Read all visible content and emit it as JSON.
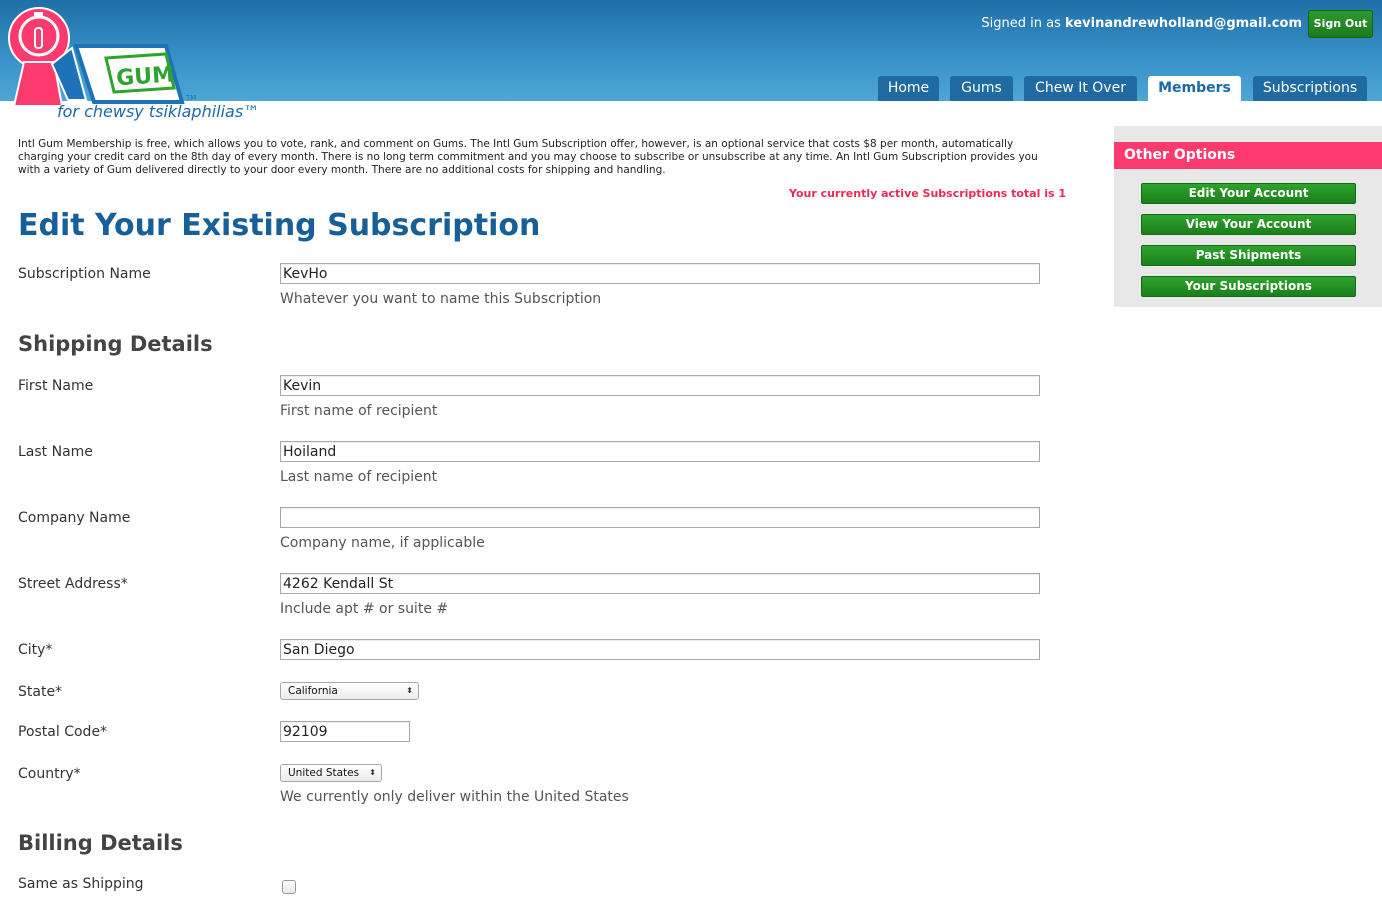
{
  "header": {
    "tagline": "for chewsy tsiklaphilias™",
    "signed_in_prefix": "Signed in as",
    "user_email": "kevinandrewholland@gmail.com",
    "sign_out_label": "Sign Out",
    "logo_text": "GUM",
    "logo_tm": "TM"
  },
  "nav": {
    "tabs": [
      {
        "label": "Home",
        "active": false
      },
      {
        "label": "Gums",
        "active": false
      },
      {
        "label": "Chew It Over",
        "active": false
      },
      {
        "label": "Members",
        "active": true
      },
      {
        "label": "Subscriptions",
        "active": false
      }
    ]
  },
  "main": {
    "intro": "Intl Gum Membership is free, which allows you to vote, rank, and comment on Gums. The Intl Gum Subscription offer, however, is an optional service that costs $8 per month, automatically charging your credit card on the 8th day of every month. There is no long term commitment and you may choose to subscribe or unsubscribe at any time. An Intl Gum Subscription provides you with a variety of Gum delivered directly to your door every month. There are no additional costs for shipping and handling.",
    "active_total": "Your currently active Subscriptions total is 1",
    "page_title": "Edit Your Existing Subscription",
    "subscription_name": {
      "label": "Subscription Name",
      "value": "KevHo",
      "help": "Whatever you want to name this Subscription"
    },
    "shipping_title": "Shipping Details",
    "first_name": {
      "label": "First Name",
      "value": "Kevin",
      "help": "First name of recipient"
    },
    "last_name": {
      "label": "Last Name",
      "value": "Hoiland",
      "help": "Last name of recipient"
    },
    "company": {
      "label": "Company Name",
      "value": "",
      "help": "Company name, if applicable"
    },
    "street": {
      "label": "Street Address*",
      "value": "4262 Kendall St",
      "help": "Include apt # or suite #"
    },
    "city": {
      "label": "City*",
      "value": "San Diego"
    },
    "state": {
      "label": "State*",
      "value": "California"
    },
    "postal": {
      "label": "Postal Code*",
      "value": "92109"
    },
    "country": {
      "label": "Country*",
      "value": "United States",
      "help": "We currently only deliver within the United States"
    },
    "billing_title": "Billing Details",
    "same_as_shipping": {
      "label": "Same as Shipping",
      "checked": false
    }
  },
  "sidebar": {
    "title": "Other Options",
    "buttons": [
      {
        "label": "Edit Your Account"
      },
      {
        "label": "View Your Account"
      },
      {
        "label": "Past Shipments"
      },
      {
        "label": "Your Subscriptions"
      }
    ]
  },
  "colors": {
    "header_blue": "#1f6fa8",
    "title_blue": "#175f98",
    "accent_pink": "#fd3a6d",
    "button_green": "#2ea32e"
  }
}
